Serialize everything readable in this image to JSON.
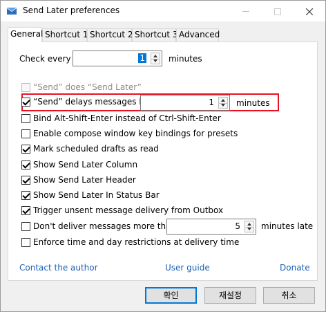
{
  "window": {
    "title": "Send Later preferences"
  },
  "tabs": [
    {
      "label": "General"
    },
    {
      "label": "Shortcut 1"
    },
    {
      "label": "Shortcut 2"
    },
    {
      "label": "Shortcut 3"
    },
    {
      "label": "Advanced"
    }
  ],
  "check_every": {
    "label": "Check every :",
    "value": "1",
    "unit": "minutes"
  },
  "options": {
    "send_does_send_later": {
      "label": "“Send” does “Send Later”",
      "checked": false,
      "enabled": false
    },
    "send_delays": {
      "label": "“Send” delays messages by:",
      "checked": true,
      "value": "1",
      "unit": "minutes"
    },
    "bind_alt_shift_enter": {
      "label": "Bind Alt-Shift-Enter instead of Ctrl-Shift-Enter",
      "checked": false
    },
    "compose_key_bindings": {
      "label": "Enable compose window key bindings for presets",
      "checked": false
    },
    "mark_scheduled_read": {
      "label": "Mark scheduled drafts as read",
      "checked": true
    },
    "show_column": {
      "label": "Show Send Later Column",
      "checked": true
    },
    "show_header": {
      "label": "Show Send Later Header",
      "checked": true
    },
    "show_status_bar": {
      "label": "Show Send Later In Status Bar",
      "checked": true
    },
    "trigger_outbox": {
      "label": "Trigger unsent message delivery from Outbox",
      "checked": true
    },
    "dont_deliver_late": {
      "label": "Don't deliver messages more than",
      "checked": false,
      "value": "5",
      "unit": "minutes late"
    },
    "enforce_restrictions": {
      "label": "Enforce time and day restrictions at delivery time",
      "checked": false
    }
  },
  "links": {
    "contact": "Contact the author",
    "guide": "User guide",
    "donate": "Donate"
  },
  "buttons": {
    "ok": "확인",
    "reset": "재설정",
    "cancel": "취소"
  },
  "colors": {
    "accent": "#0078d7",
    "highlight_border": "#e81123",
    "link": "#1a5fb4"
  },
  "icons": {
    "app": "envelope-icon"
  }
}
